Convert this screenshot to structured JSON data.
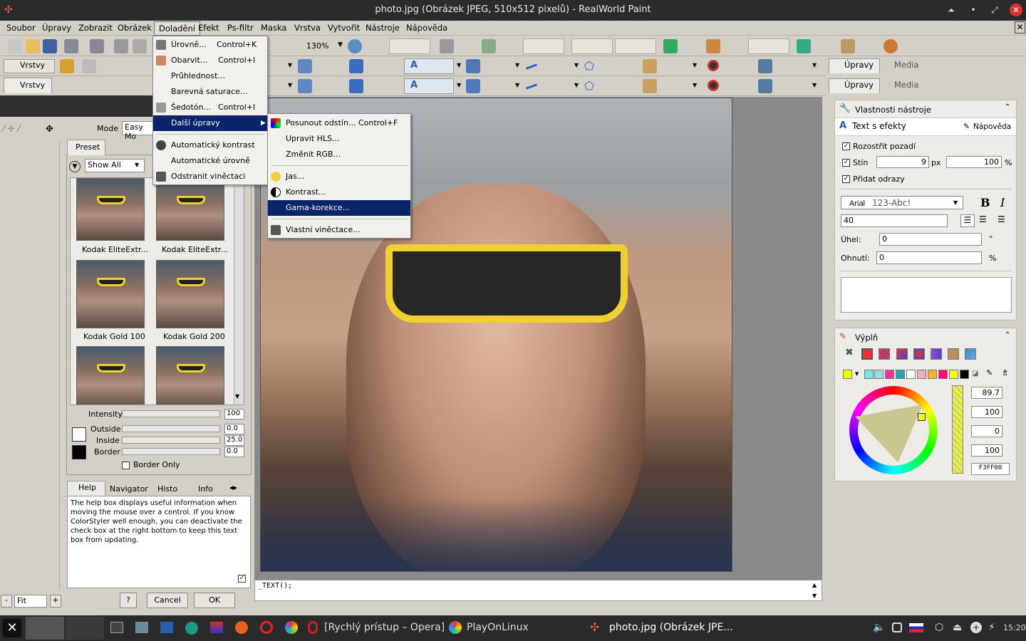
{
  "window": {
    "title": "photo.jpg (Obrázek JPEG, 510x512 pixelů) - RealWorld Paint"
  },
  "menubar": [
    "Soubor",
    "Úpravy",
    "Zobrazit",
    "Obrázek",
    "Doladění",
    "Efekt",
    "Ps-filtr",
    "Maska",
    "Vrstva",
    "Vytvořit",
    "Nástroje",
    "Nápověda"
  ],
  "toolbar": {
    "zoom": "130%"
  },
  "left": {
    "layers_tab": "Vrstvy",
    "layers_tab_short": "Vrstvy",
    "mode_label": "Mode",
    "mode_value": "Easy Mo",
    "preset_tab": "Preset",
    "filter_value": "Show All",
    "presets": [
      "Kodak EliteExtr...",
      "Kodak EliteExtr...",
      "Kodak Gold 100",
      "Kodak Gold 200"
    ],
    "sliders": {
      "intensity_label": "Intensity",
      "intensity": "100",
      "outside_label": "Outside",
      "outside": "0.0",
      "inside_label": "Inside",
      "inside": "25.0",
      "border_label": "Border",
      "border": "0.0"
    },
    "border_only": "Border Only",
    "tabs": [
      "Help",
      "Navigator",
      "Histo",
      "Info"
    ],
    "help_text": "The help box displays useful information when moving the mouse over a control. If you know ColorStyler well enough, you can deactivate the check box at the right bottom to keep this text box from updating.",
    "fit_value": "Fit",
    "help_btn": "?",
    "cancel": "Cancel",
    "ok": "OK"
  },
  "menu_doladeni": [
    {
      "label": "Úrovně...",
      "shortcut": "Control+K"
    },
    {
      "label": "Obarvit...",
      "shortcut": "Control+I"
    },
    {
      "label": "Průhlednost...",
      "shortcut": ""
    },
    {
      "label": "Barevná saturace...",
      "shortcut": ""
    },
    {
      "label": "Šedotón...",
      "shortcut": "Control+I"
    },
    {
      "label": "Další úpravy",
      "shortcut": ""
    },
    {
      "label": "Automatický kontrast",
      "shortcut": ""
    },
    {
      "label": "Automatické úrovně",
      "shortcut": ""
    },
    {
      "label": "Odstranit viněctaci",
      "shortcut": ""
    }
  ],
  "submenu": [
    {
      "label": "Posunout odstín...",
      "shortcut": "Control+F"
    },
    {
      "label": "Upravit HLS...",
      "shortcut": ""
    },
    {
      "label": "Změnit RGB...",
      "shortcut": ""
    },
    {
      "label": "Jas...",
      "shortcut": ""
    },
    {
      "label": "Kontrast...",
      "shortcut": ""
    },
    {
      "label": "Gama-korekce...",
      "shortcut": ""
    },
    {
      "label": "Vlastní viněctace...",
      "shortcut": ""
    }
  ],
  "script_text": "_TEXT();",
  "right": {
    "tab1": "Úpravy",
    "tab2": "Media",
    "props_title": "Vlastnosti nástroje",
    "tool_name": "Text s efekty",
    "help": "Nápověda",
    "blur_bg": "Rozostřit pozadí",
    "shadow": "Stín",
    "shadow_val": "9",
    "px": "px",
    "shadow_pct": "100",
    "pct": "%",
    "reflect": "Přidat odrazy",
    "font": "Arial",
    "font_sample": "123-Abc!",
    "size": "40",
    "angle_label": "Úhel:",
    "angle": "0",
    "deg": "°",
    "bend_label": "Ohnutí:",
    "bend": "0",
    "fill_title": "Výplň",
    "hue": "89.7",
    "sat": "100",
    "val3": "0",
    "alpha": "100",
    "hex": "F3FF00",
    "bold": "B",
    "italic": "I"
  },
  "taskbar": {
    "opera": "[Rychlý prístup – Opera]",
    "playonlinux": "PlayOnLinux",
    "paint": "photo.jpg (Obrázek JPE...",
    "clock": "15:20"
  },
  "colors": {
    "accent": "#0a246a",
    "highlight_yellow": "#f3ff00"
  }
}
